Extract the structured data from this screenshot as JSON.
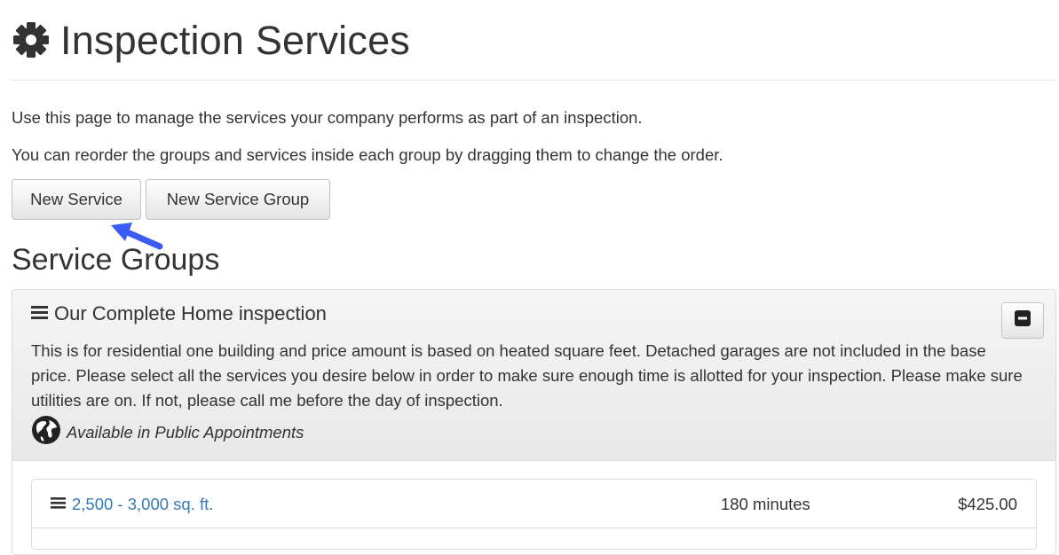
{
  "page": {
    "title": "Inspection Services",
    "title_icon": "gear-icon",
    "intro_line1": "Use this page to manage the services your company performs as part of an inspection.",
    "intro_line2": "You can reorder the groups and services inside each group by dragging them to change the order."
  },
  "toolbar": {
    "new_service_label": "New Service",
    "new_group_label": "New Service Group"
  },
  "annotation": {
    "arrow_icon": "pointer-arrow-icon",
    "arrow_color": "#3b5bf5"
  },
  "section": {
    "title": "Service Groups"
  },
  "groups": [
    {
      "title": "Our Complete Home inspection",
      "description": "This is for residential one building and price amount is based on heated square feet. Detached garages are not included in the base price. Please select all the services you desire below in order to make sure enough time is allotted for your inspection. Please make sure utilities are on. If not, please call me before the day of inspection.",
      "public_label": "Available in Public Appointments",
      "public_icon": "globe-icon",
      "collapse_icon": "minus-square-icon",
      "drag_icon": "bars-icon",
      "services": [
        {
          "name": "2,500 - 3,000 sq. ft.",
          "duration": "180 minutes",
          "price": "$425.00"
        }
      ]
    }
  ],
  "colors": {
    "link": "#337ab7",
    "text": "#333333",
    "panel_heading": "#eeeeee",
    "border": "#dddddd"
  }
}
